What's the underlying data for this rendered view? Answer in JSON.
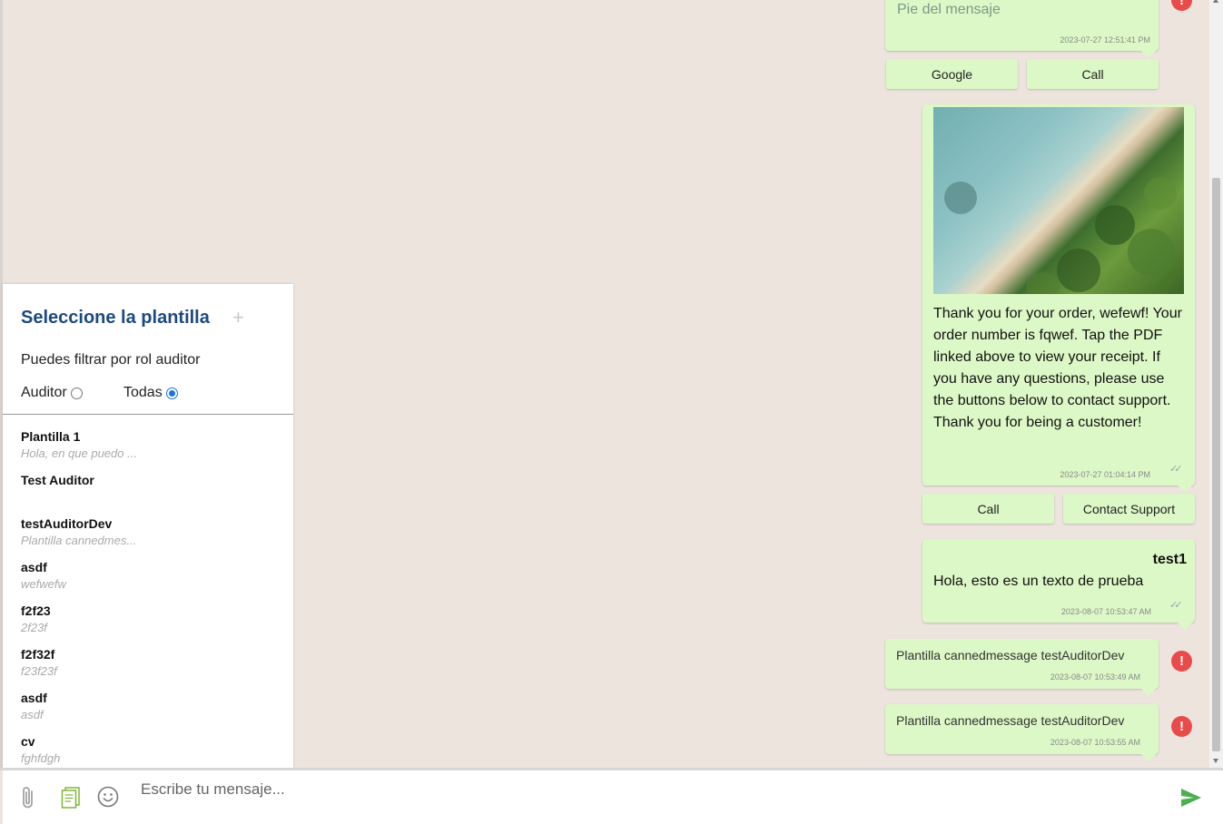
{
  "colors": {
    "bubble": "#dcf8c6",
    "chat_bg": "#ede4de",
    "title": "#1c4a80",
    "error": "#e94b4b",
    "send": "#4caf50"
  },
  "messages": {
    "m1": {
      "footer": "Pie del mensaje",
      "timestamp": "2023-07-27 12:51:41 PM",
      "buttons": [
        "Google",
        "Call"
      ],
      "status": "error"
    },
    "m2": {
      "image": "beach-aerial-photo",
      "text": "Thank you for your order, wefewf! Your order number is fqwef. Tap the PDF linked above to view your receipt. If you have any questions, please use the buttons below to contact support. Thank you for being a customer!",
      "timestamp": "2023-07-27 01:04:14 PM",
      "buttons": [
        "Call",
        "Contact Support"
      ]
    },
    "m3": {
      "header": "test1",
      "text": "Hola, esto es un texto de prueba",
      "timestamp": "2023-08-07 10:53:47 AM"
    },
    "m4": {
      "text": "Plantilla cannedmessage testAuditorDev",
      "timestamp": "2023-08-07 10:53:49 AM",
      "status": "error"
    },
    "m5": {
      "text": "Plantilla cannedmessage testAuditorDev",
      "timestamp": "2023-08-07 10:53:55 AM",
      "status": "error"
    }
  },
  "panel": {
    "title": "Seleccione la plantilla",
    "plus": "+",
    "filter_label": "Puedes filtrar por rol auditor",
    "radio_auditor": "Auditor",
    "radio_todas": "Todas",
    "selected": "Todas",
    "templates": [
      {
        "name": "Plantilla 1",
        "preview": "Hola, en que puedo ..."
      },
      {
        "name": "Test Auditor",
        "preview": ""
      },
      {
        "name": "testAuditorDev",
        "preview": "Plantilla cannedmes..."
      },
      {
        "name": "asdf",
        "preview": "wefwefw"
      },
      {
        "name": "f2f23",
        "preview": "2f23f"
      },
      {
        "name": "f2f32f",
        "preview": "f23f23f"
      },
      {
        "name": "asdf",
        "preview": "asdf"
      },
      {
        "name": "cv",
        "preview": "fghfdgh"
      }
    ]
  },
  "composer": {
    "placeholder": "Escribe tu mensaje...",
    "icons": [
      "paperclip-icon",
      "template-icon",
      "emoji-icon",
      "send-icon"
    ]
  }
}
